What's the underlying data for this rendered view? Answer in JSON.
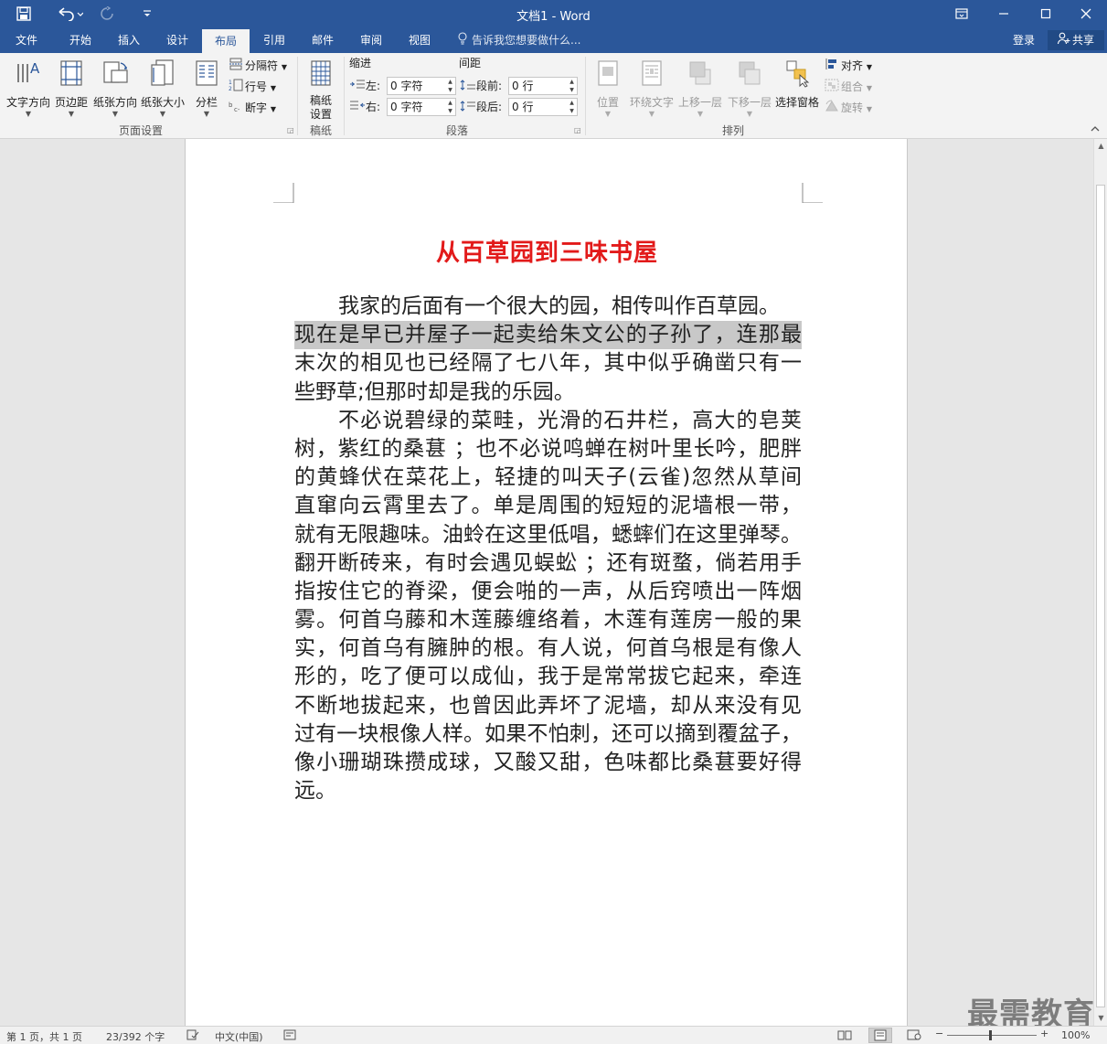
{
  "titlebar": {
    "title": "文档1 - Word",
    "quick_access": [
      "save-icon",
      "undo-icon",
      "redo-icon",
      "customize-icon"
    ],
    "window_controls": [
      "ribbon-display-icon",
      "minimize-icon",
      "maximize-icon",
      "close-icon"
    ]
  },
  "tabs": {
    "items": [
      {
        "label": "文件"
      },
      {
        "label": "开始"
      },
      {
        "label": "插入"
      },
      {
        "label": "设计"
      },
      {
        "label": "布局",
        "active": true
      },
      {
        "label": "引用"
      },
      {
        "label": "邮件"
      },
      {
        "label": "审阅"
      },
      {
        "label": "视图"
      }
    ],
    "tell_me": "告诉我您想要做什么...",
    "login": "登录",
    "share": "共享"
  },
  "ribbon": {
    "page_setup": {
      "label": "页面设置",
      "text_direction": "文字方向",
      "margins": "页边距",
      "orientation": "纸张方向",
      "size": "纸张大小",
      "columns": "分栏",
      "breaks": "分隔符",
      "line_numbers": "行号",
      "hyphenation": "断字"
    },
    "manuscript": {
      "label": "稿纸",
      "settings_line1": "稿纸",
      "settings_line2": "设置"
    },
    "paragraph": {
      "label": "段落",
      "indent_header": "缩进",
      "spacing_header": "间距",
      "left_label": "左:",
      "left_value": "0 字符",
      "right_label": "右:",
      "right_value": "0 字符",
      "before_label": "段前:",
      "before_value": "0 行",
      "after_label": "段后:",
      "after_value": "0 行"
    },
    "arrange": {
      "label": "排列",
      "position": "位置",
      "wrap_text": "环绕文字",
      "bring_forward": "上移一层",
      "send_backward": "下移一层",
      "selection_pane": "选择窗格",
      "align": "对齐",
      "group": "组合",
      "rotate": "旋转"
    }
  },
  "document": {
    "title": "从百草园到三味书屋",
    "lines": [
      {
        "text": "我家的后面有一个很大的园，相传叫作百草园。",
        "indent": true
      },
      {
        "text": "现在是早已并屋子一起卖给朱文公的子孙了，连那最",
        "selected": true,
        "justify": true
      },
      {
        "text": "末次的相见也已经隔了七八年，其中似乎确凿只有一",
        "justify": true
      },
      {
        "text": "些野草;但那时却是我的乐园。"
      },
      {
        "text": "不必说碧绿的菜畦，光滑的石井栏，高大的皂荚",
        "indent": true,
        "justify": true
      },
      {
        "text": "树，紫红的桑葚 ；也不必说鸣蝉在树叶里长吟，肥胖",
        "justify": true
      },
      {
        "text": "的黄蜂伏在菜花上，轻捷的叫天子(云雀)忽然从草间",
        "justify": true
      },
      {
        "text": "直窜向云霄里去了。单是周围的短短的泥墙根一带，",
        "justify": true
      },
      {
        "text": "就有无限趣味。油蛉在这里低唱，蟋蟀们在这里弹琴。",
        "justify": true
      },
      {
        "text": "翻开断砖来，有时会遇见蜈蚣 ；还有斑蝥，倘若用手",
        "justify": true
      },
      {
        "text": "指按住它的脊梁，便会啪的一声，从后窍喷出一阵烟",
        "justify": true
      },
      {
        "text": "雾。何首乌藤和木莲藤缠络着，木莲有莲房一般的果",
        "justify": true
      },
      {
        "text": "实，何首乌有臃肿的根。有人说，何首乌根是有像人",
        "justify": true
      },
      {
        "text": "形的，吃了便可以成仙，我于是常常拔它起来，牵连",
        "justify": true
      },
      {
        "text": "不断地拔起来，也曾因此弄坏了泥墙，却从来没有见",
        "justify": true
      },
      {
        "text": "过有一块根像人样。如果不怕刺，还可以摘到覆盆子，",
        "justify": true
      },
      {
        "text": "像小珊瑚珠攒成球，又酸又甜，色味都比桑葚要好得",
        "justify": true
      },
      {
        "text": "远。"
      }
    ]
  },
  "statusbar": {
    "page": "第 1 页，共 1 页",
    "words": "23/392 个字",
    "language": "中文(中国)",
    "zoom": "100%",
    "zoom_minus": "−",
    "zoom_plus": "+"
  },
  "watermark": "最需教育",
  "colors": {
    "accent": "#2b579a",
    "title_red": "#e21a1a",
    "selection": "#c8c8c8"
  }
}
